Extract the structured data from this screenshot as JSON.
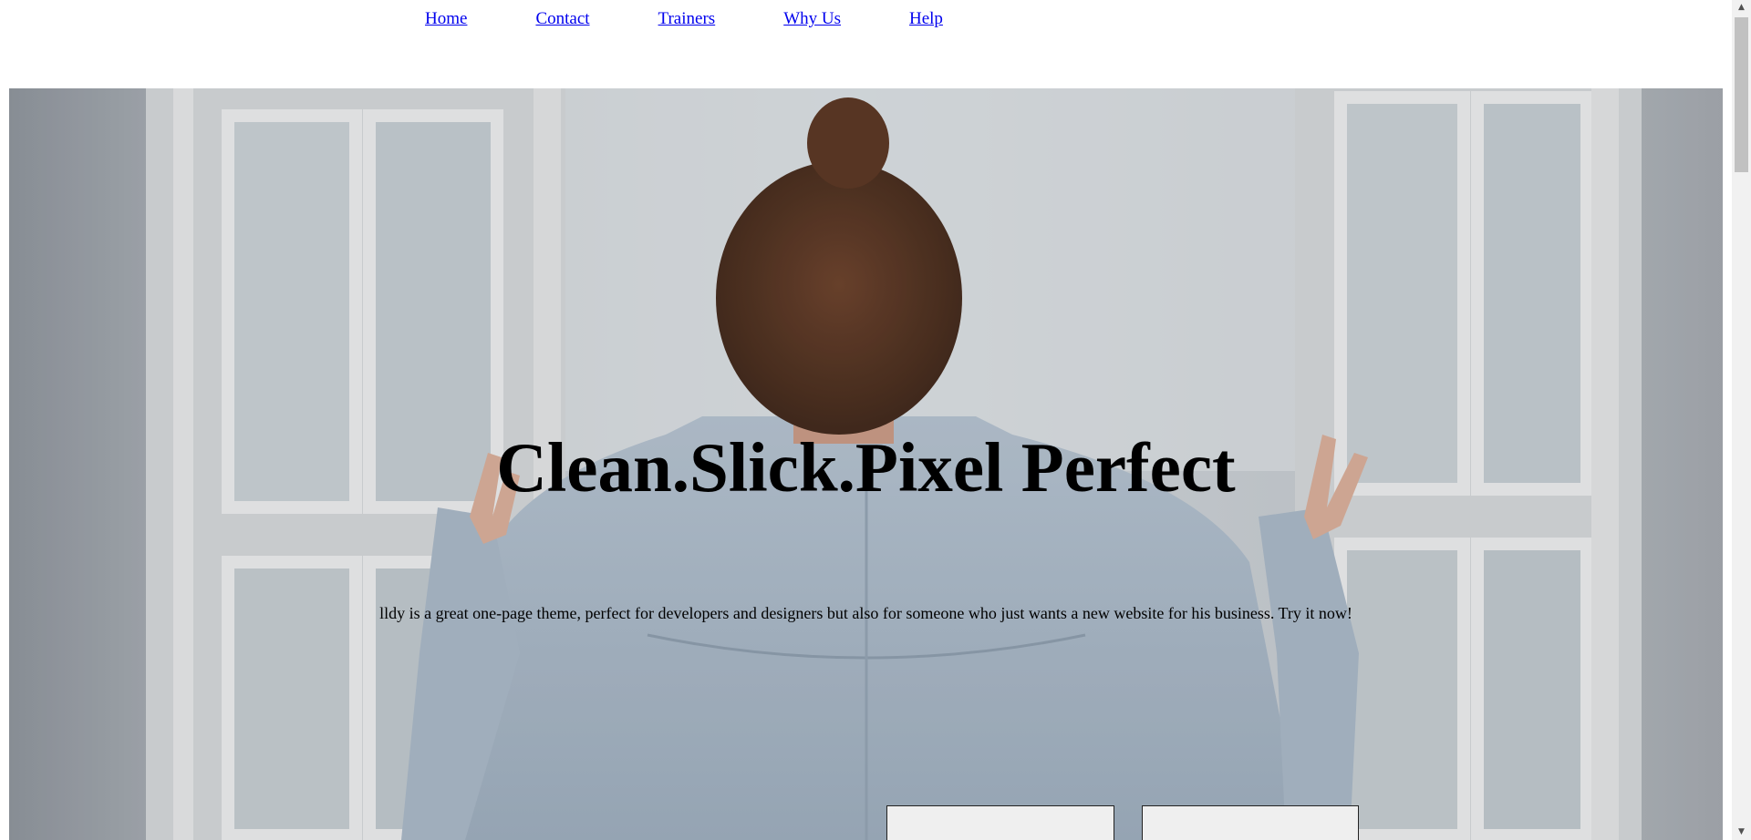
{
  "nav": {
    "items": [
      {
        "label": "Home"
      },
      {
        "label": "Contact"
      },
      {
        "label": "Trainers"
      },
      {
        "label": "Why Us"
      },
      {
        "label": "Help"
      }
    ]
  },
  "hero": {
    "title": "Clean.Slick.Pixel Perfect",
    "subtitle": "lldy is a great one-page theme, perfect for developers and designers but also for someone who just wants a new website for his business. Try it now!",
    "buttons": [
      {
        "label": ""
      },
      {
        "label": ""
      }
    ]
  },
  "colors": {
    "link": "#0000ee",
    "button_bg": "#efefef"
  }
}
